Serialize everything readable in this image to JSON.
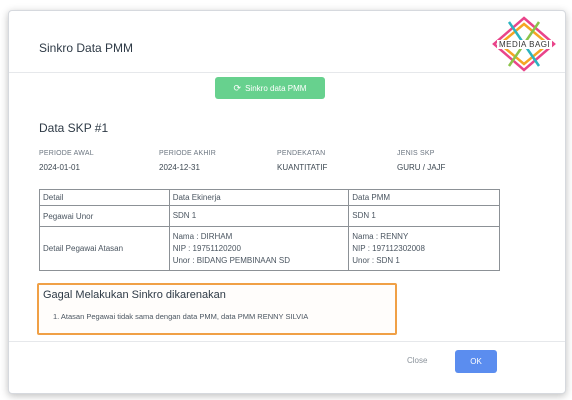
{
  "modal": {
    "title": "Sinkro Data PMM",
    "sync_button": "Sinkro data PMM",
    "section_title": "Data SKP #1"
  },
  "meta": [
    {
      "label": "PERIODE AWAL",
      "value": "2024-01-01"
    },
    {
      "label": "PERIODE AKHIR",
      "value": "2024-12-31"
    },
    {
      "label": "PENDEKATAN",
      "value": "KUANTITATIF"
    },
    {
      "label": "JENIS SKP",
      "value": "GURU / JAJF"
    }
  ],
  "table": {
    "headers": [
      "Detail",
      "Data Ekinerja",
      "Data PMM"
    ],
    "rows": [
      {
        "label": "Pegawai Unor",
        "ekinerja": [
          "SDN 1"
        ],
        "pmm": [
          "SDN 1"
        ]
      },
      {
        "label": "Detail Pegawai Atasan",
        "ekinerja": [
          "Nama : DIRHAM",
          "NIP : 19751120200",
          "Unor : BIDANG PEMBINAAN SD"
        ],
        "pmm": [
          "Nama : RENNY",
          "NIP : 197112302008",
          "Unor : SDN 1"
        ]
      }
    ]
  },
  "error": {
    "title": "Gagal Melakukan Sinkro dikarenakan",
    "items": [
      "1. Atasan Pegawai tidak sama dengan data PMM, data PMM RENNY SILVIA"
    ]
  },
  "footer": {
    "close_label": "Close",
    "ok_label": "OK"
  },
  "watermark": {
    "text": "MEDIA BAGI",
    "colors": [
      "#e9448a",
      "#f5a623",
      "#2bb3c0",
      "#8bc34a"
    ]
  }
}
